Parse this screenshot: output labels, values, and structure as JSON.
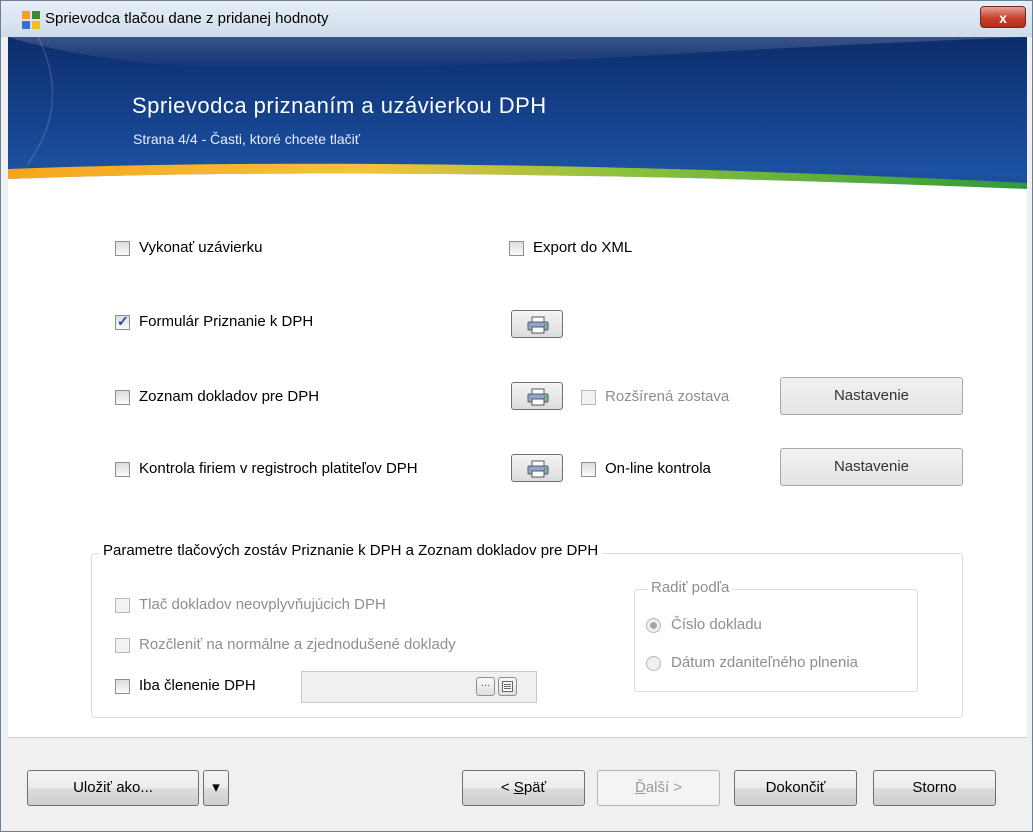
{
  "window": {
    "title": "Sprievodca tlačou dane z pridanej hodnoty",
    "close_label": "x"
  },
  "banner": {
    "title": "Sprievodca priznaním a uzávierkou DPH",
    "subtitle": "Strana 4/4 - Časti, ktoré chcete tlačiť"
  },
  "options": {
    "vykonat": {
      "label": "Vykonať uzávierku",
      "checked": false
    },
    "export_xml": {
      "label": "Export do XML",
      "checked": false
    },
    "formular": {
      "label": "Formulár Priznanie k DPH",
      "checked": true
    },
    "zoznam": {
      "label": "Zoznam dokladov pre DPH",
      "checked": false
    },
    "kontrola": {
      "label": "Kontrola firiem v registroch platiteľov DPH",
      "checked": false
    },
    "rozsirena": {
      "label": "Rozšírená zostava",
      "checked": false,
      "disabled": true
    },
    "online": {
      "label": "On-line kontrola",
      "checked": false
    }
  },
  "buttons": {
    "nastavenie_1": "Nastavenie",
    "nastavenie_2": "Nastavenie"
  },
  "params": {
    "title": "Parametre tlačových zostáv Priznanie k DPH a Zoznam dokladov pre DPH",
    "tlac": {
      "label": "Tlač dokladov neovplyvňujúcich DPH",
      "disabled": true
    },
    "rozclenit": {
      "label": "Rozčleniť na normálne a zjednodušené doklady",
      "disabled": true
    },
    "iba": {
      "label": "Iba členenie DPH",
      "checked": false
    },
    "combo_value": "",
    "browse_label": "···",
    "sort": {
      "title": "Radiť podľa",
      "option1": "Číslo dokladu",
      "option2": "Dátum zdaniteľného plnenia",
      "selected": "option1"
    }
  },
  "footer": {
    "ulozit": "Uložiť ako...",
    "dropdown": "▾",
    "spat_pre": "< ",
    "spat_u": "S",
    "spat_post": "päť",
    "dalsi_u": "Ď",
    "dalsi_post": "alší >",
    "dokoncit": "Dokončiť",
    "storno": "Storno"
  },
  "colors": {
    "banner_dark": "#0d2d6b",
    "banner_mid": "#1b4fa0",
    "swoosh_orange": "#f59a1b",
    "swoosh_green": "#37a23a",
    "checkmark_blue": "#1d4ca3"
  }
}
